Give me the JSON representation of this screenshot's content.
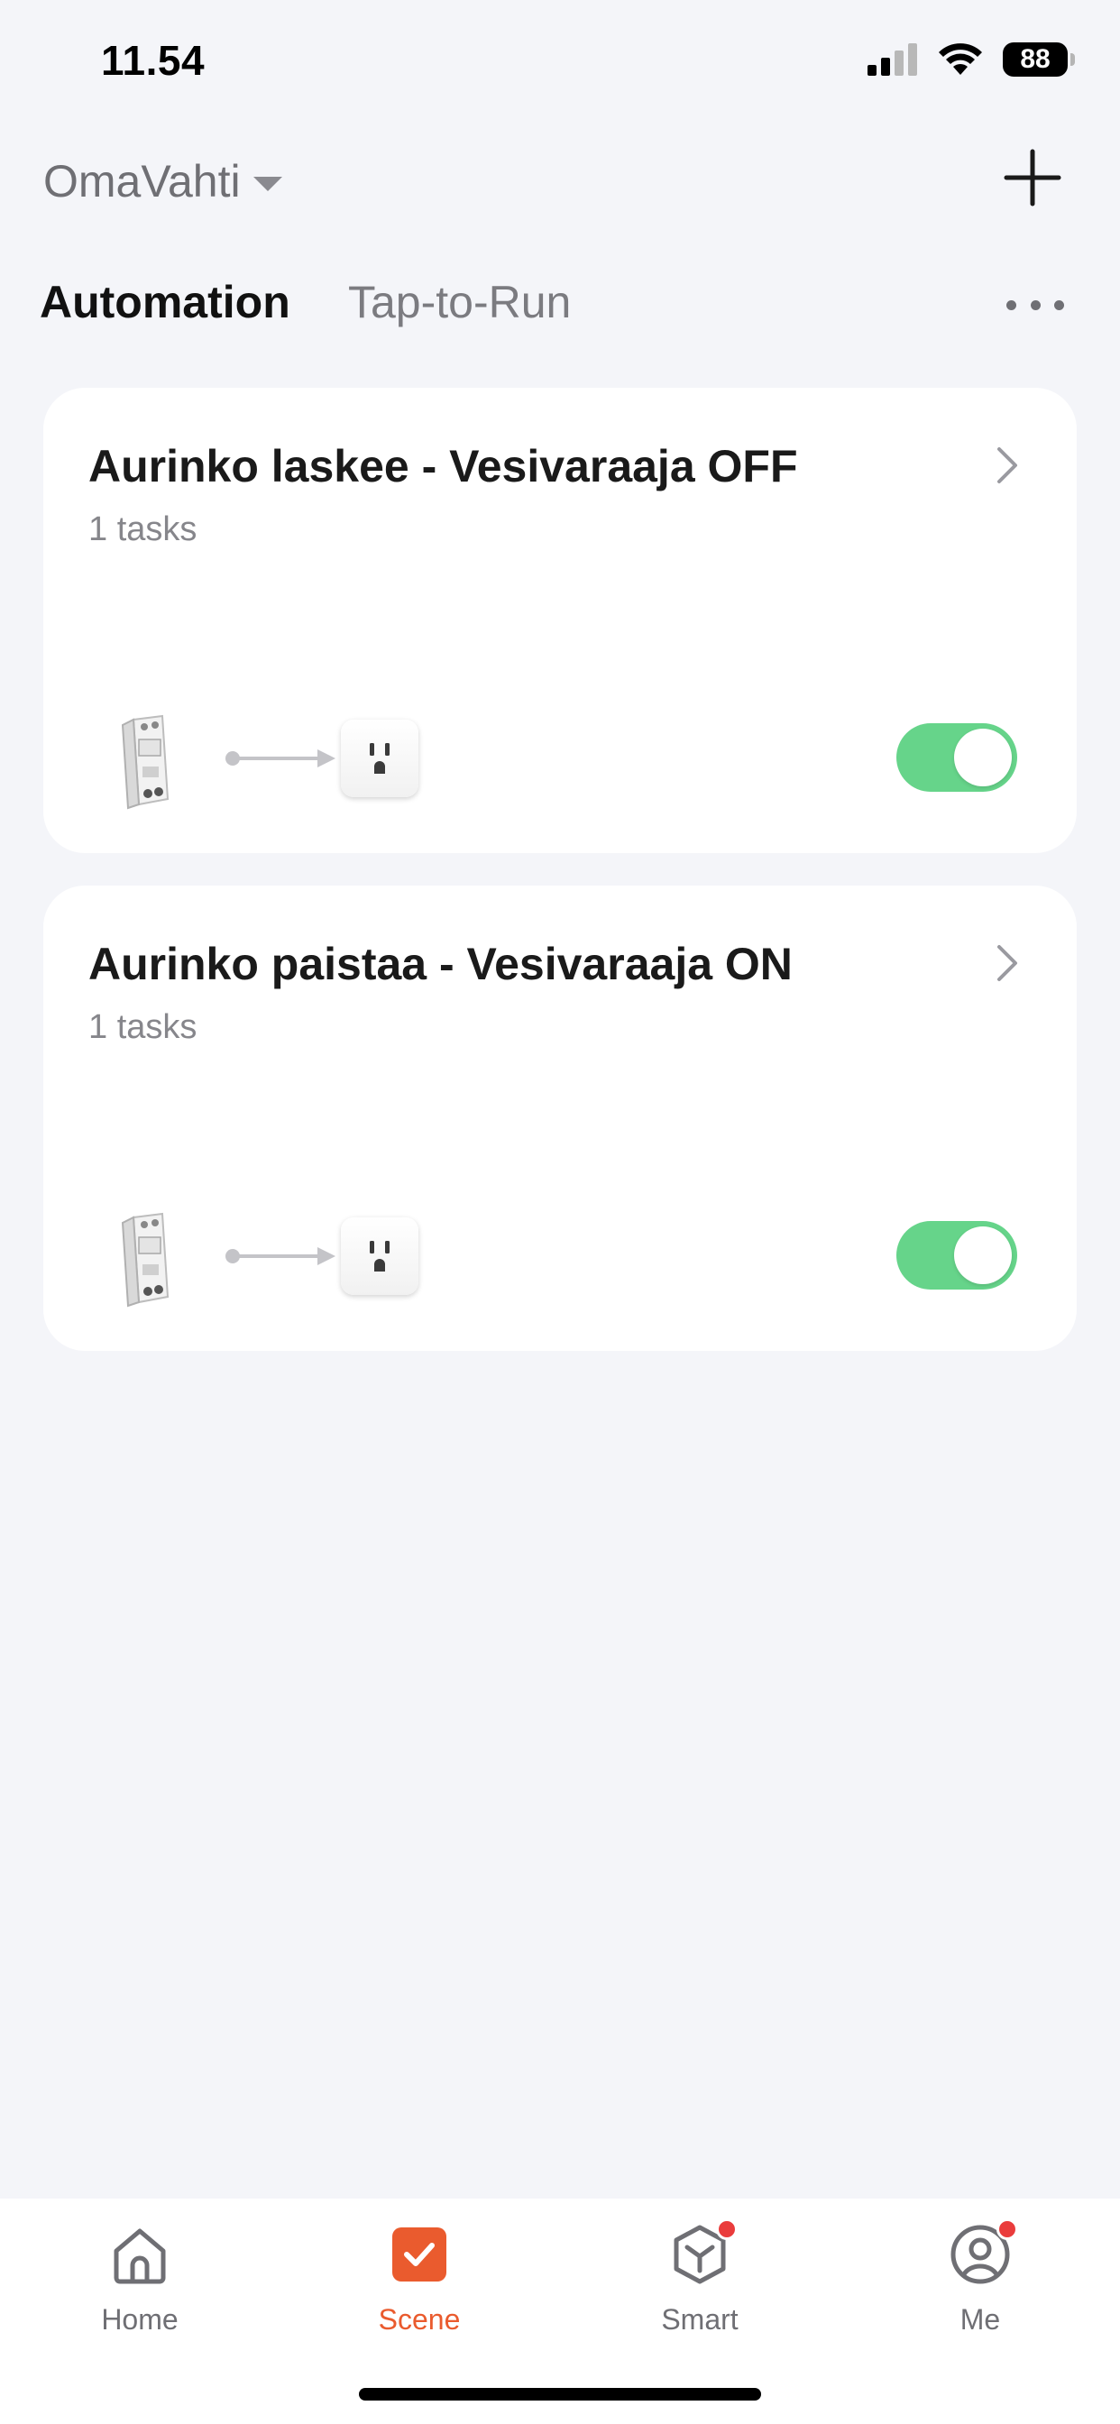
{
  "status_bar": {
    "time": "11.54",
    "battery": "88",
    "signal_icon": "cellular-signal-icon",
    "wifi_icon": "wifi-icon"
  },
  "header": {
    "home_name": "OmaVahti",
    "add_icon": "plus-icon"
  },
  "tabs": {
    "automation": "Automation",
    "tap_to_run": "Tap-to-Run",
    "more_icon": "more-dots-icon"
  },
  "automations": [
    {
      "title": "Aurinko laskee - Vesivaraaja OFF",
      "subtitle": "1 tasks",
      "enabled": true,
      "condition_icon": "din-rail-relay-icon",
      "action_icon": "socket-icon"
    },
    {
      "title": "Aurinko paistaa - Vesivaraaja ON",
      "subtitle": "1 tasks",
      "enabled": true,
      "condition_icon": "din-rail-relay-icon",
      "action_icon": "socket-icon"
    }
  ],
  "tabbar": {
    "items": [
      {
        "label": "Home",
        "icon": "home-icon",
        "active": false,
        "badge": false
      },
      {
        "label": "Scene",
        "icon": "scene-check-icon",
        "active": true,
        "badge": false
      },
      {
        "label": "Smart",
        "icon": "smart-cube-icon",
        "active": false,
        "badge": true
      },
      {
        "label": "Me",
        "icon": "profile-icon",
        "active": false,
        "badge": true
      }
    ]
  },
  "colors": {
    "background": "#f4f5f9",
    "toggle_on": "#66d48a",
    "accent": "#ea5b2e",
    "badge": "#ea3c3c"
  }
}
